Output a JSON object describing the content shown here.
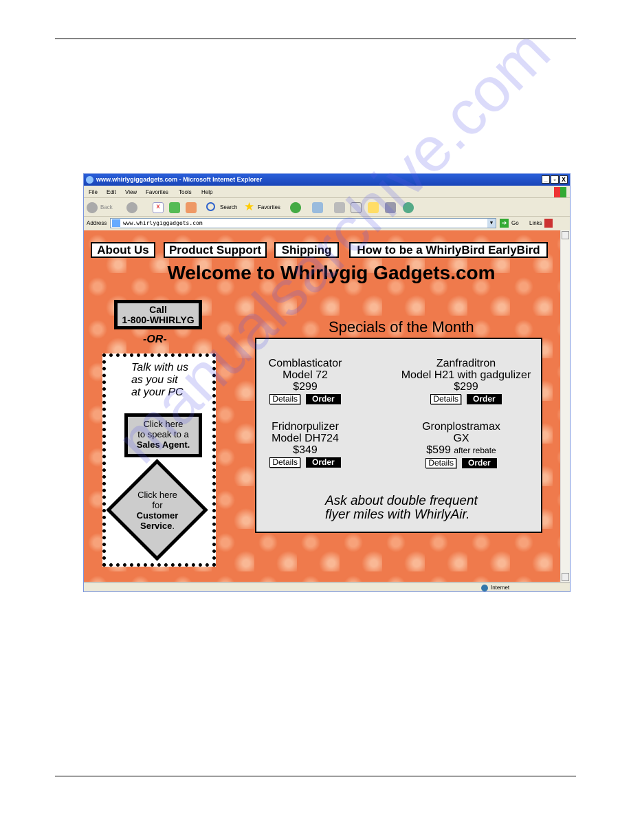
{
  "browser": {
    "title": "www.whirlygiggadgets.com - Microsoft Internet Explorer",
    "window_buttons": [
      "_",
      "▫",
      "X"
    ],
    "menu": [
      "File",
      "Edit",
      "View",
      "Favorites",
      "Tools",
      "Help"
    ],
    "toolbar": {
      "back": "Back",
      "search": "Search",
      "favorites": "Favorites"
    },
    "address_label": "Address",
    "address_value": "www.whirlygiggadgets.com",
    "go": "Go",
    "links": "Links",
    "status_zone": "Internet"
  },
  "site": {
    "nav": [
      "About Us",
      "Product Support",
      "Shipping",
      "How to be a WhirlyBird EarlyBird"
    ],
    "title": "Welcome to Whirlygig Gadgets.com",
    "call": [
      "Call",
      "1-800-WHIRLYG"
    ],
    "or": "-OR-",
    "talk": [
      "Talk with us",
      "as you sit",
      "at your PC"
    ],
    "sales": {
      "line1": "Click here",
      "line2": "to speak to a",
      "bold": "Sales Agent",
      "end": "."
    },
    "service": {
      "line1": "Click here",
      "line2": "for",
      "bold1": "Customer",
      "bold2": "Service",
      "end": "."
    },
    "specials_title": "Specials of the Month",
    "products": [
      {
        "name": "Comblasticator",
        "model": "Model 72",
        "price": "$299",
        "note": ""
      },
      {
        "name": "Zanfraditron",
        "model": "Model H21 with gadgulizer",
        "price": "$299",
        "note": ""
      },
      {
        "name": "Fridnorpulizer",
        "model": "Model DH724",
        "price": "$349",
        "note": ""
      },
      {
        "name": "Gronplostramax",
        "model": "GX",
        "price": "$599",
        "note": "after rebate"
      }
    ],
    "details_label": "Details",
    "order_label": "Order",
    "promo": [
      "Ask about double frequent",
      "flyer miles with WhirlyAir."
    ]
  },
  "watermark": "manualsarchive.com",
  "colors": {
    "page_bg": "#ef7a4c",
    "panel": "#e6e6e6",
    "titlebar": "#1f4fc8"
  }
}
